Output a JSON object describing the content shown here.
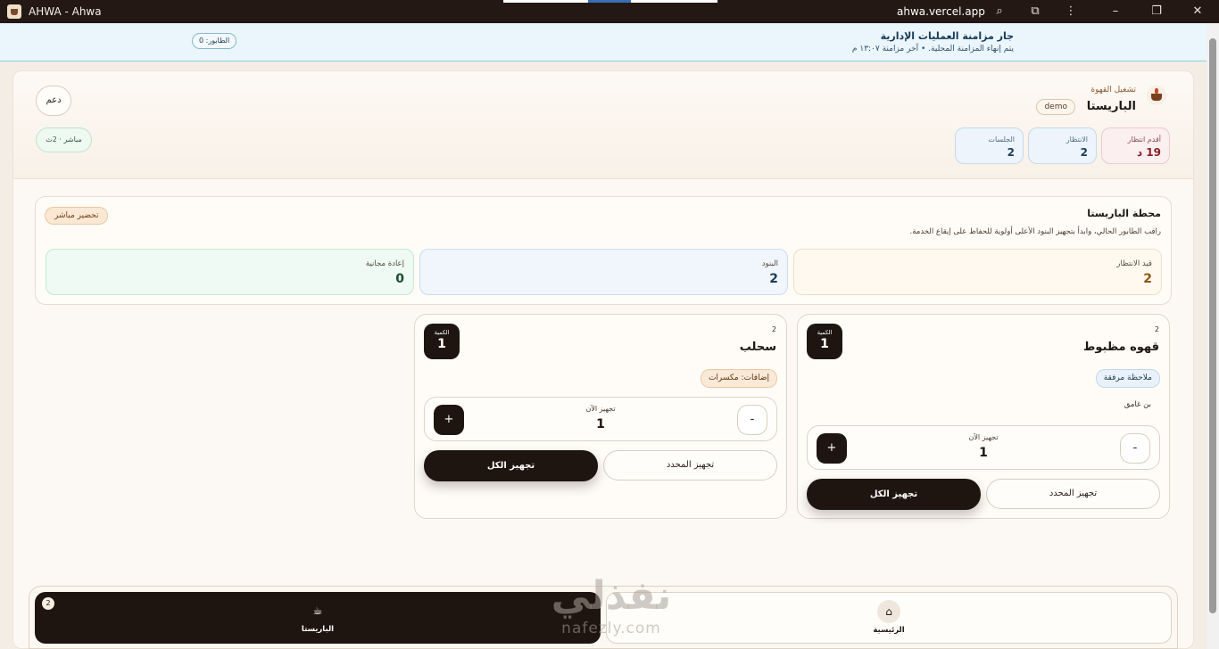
{
  "window": {
    "title": "AHWA - Ahwa",
    "url": "ahwa.vercel.app",
    "icons": [
      "app-icon",
      "zoom-icon",
      "extension-icon",
      "more-icon",
      "minimize-icon",
      "maximize-icon",
      "close-icon"
    ]
  },
  "sync": {
    "title": "جار مزامنة العمليات الإدارية",
    "subtitle": "يتم إنهاء المزامنة المحلية. • آخر مزامنة ١٣:٠٧ م",
    "queue": "الطابور: 0"
  },
  "header": {
    "subtitle": "تشغيل القهوة",
    "title": "الباريستا",
    "badge": "demo",
    "support": "دعم",
    "live": "مباشر · 2ث",
    "stats": {
      "oldest_wait_label": "أقدم انتظار",
      "oldest_wait_value": "19 د",
      "waiting_label": "الانتظار",
      "waiting_value": "2",
      "sessions_label": "الجلسات",
      "sessions_value": "2"
    }
  },
  "station": {
    "title": "محطة الباريستا",
    "description": "راقب الطابور الحالي، وابدأ بتجهيز البنود الأعلى أولوية للحفاظ على إيقاع الخدمة.",
    "live_badge": "تحضير مباشر",
    "metrics": {
      "pending_label": "قيد الانتظار",
      "pending_value": "2",
      "items_label": "البنود",
      "items_value": "2",
      "remake_label": "إعادة مجانية",
      "remake_value": "0"
    }
  },
  "orders": [
    {
      "number": "2",
      "name": "قهوه مظبوط",
      "qty_label": "الكمية",
      "qty": "1",
      "note_tag": "ملاحظة مرفقة",
      "detail": "بن غامق",
      "stepper_label": "تجهيز الآن",
      "stepper_value": "1",
      "minus": "-",
      "plus": "+",
      "select_btn": "تجهيز المحدد",
      "all_btn": "تجهيز الكل"
    },
    {
      "number": "2",
      "name": "سحلب",
      "qty_label": "الكمية",
      "qty": "1",
      "addon_tag": "إضافات: مكسرات",
      "stepper_label": "تجهيز الآن",
      "stepper_value": "1",
      "minus": "-",
      "plus": "+",
      "select_btn": "تجهيز المحدد",
      "all_btn": "تجهيز الكل"
    }
  ],
  "nav": {
    "barista_label": "الباريستا",
    "barista_badge": "2",
    "home_label": "الرئيسية"
  },
  "watermark": {
    "line1": "نفذلي",
    "line2": "nafezly.com"
  }
}
